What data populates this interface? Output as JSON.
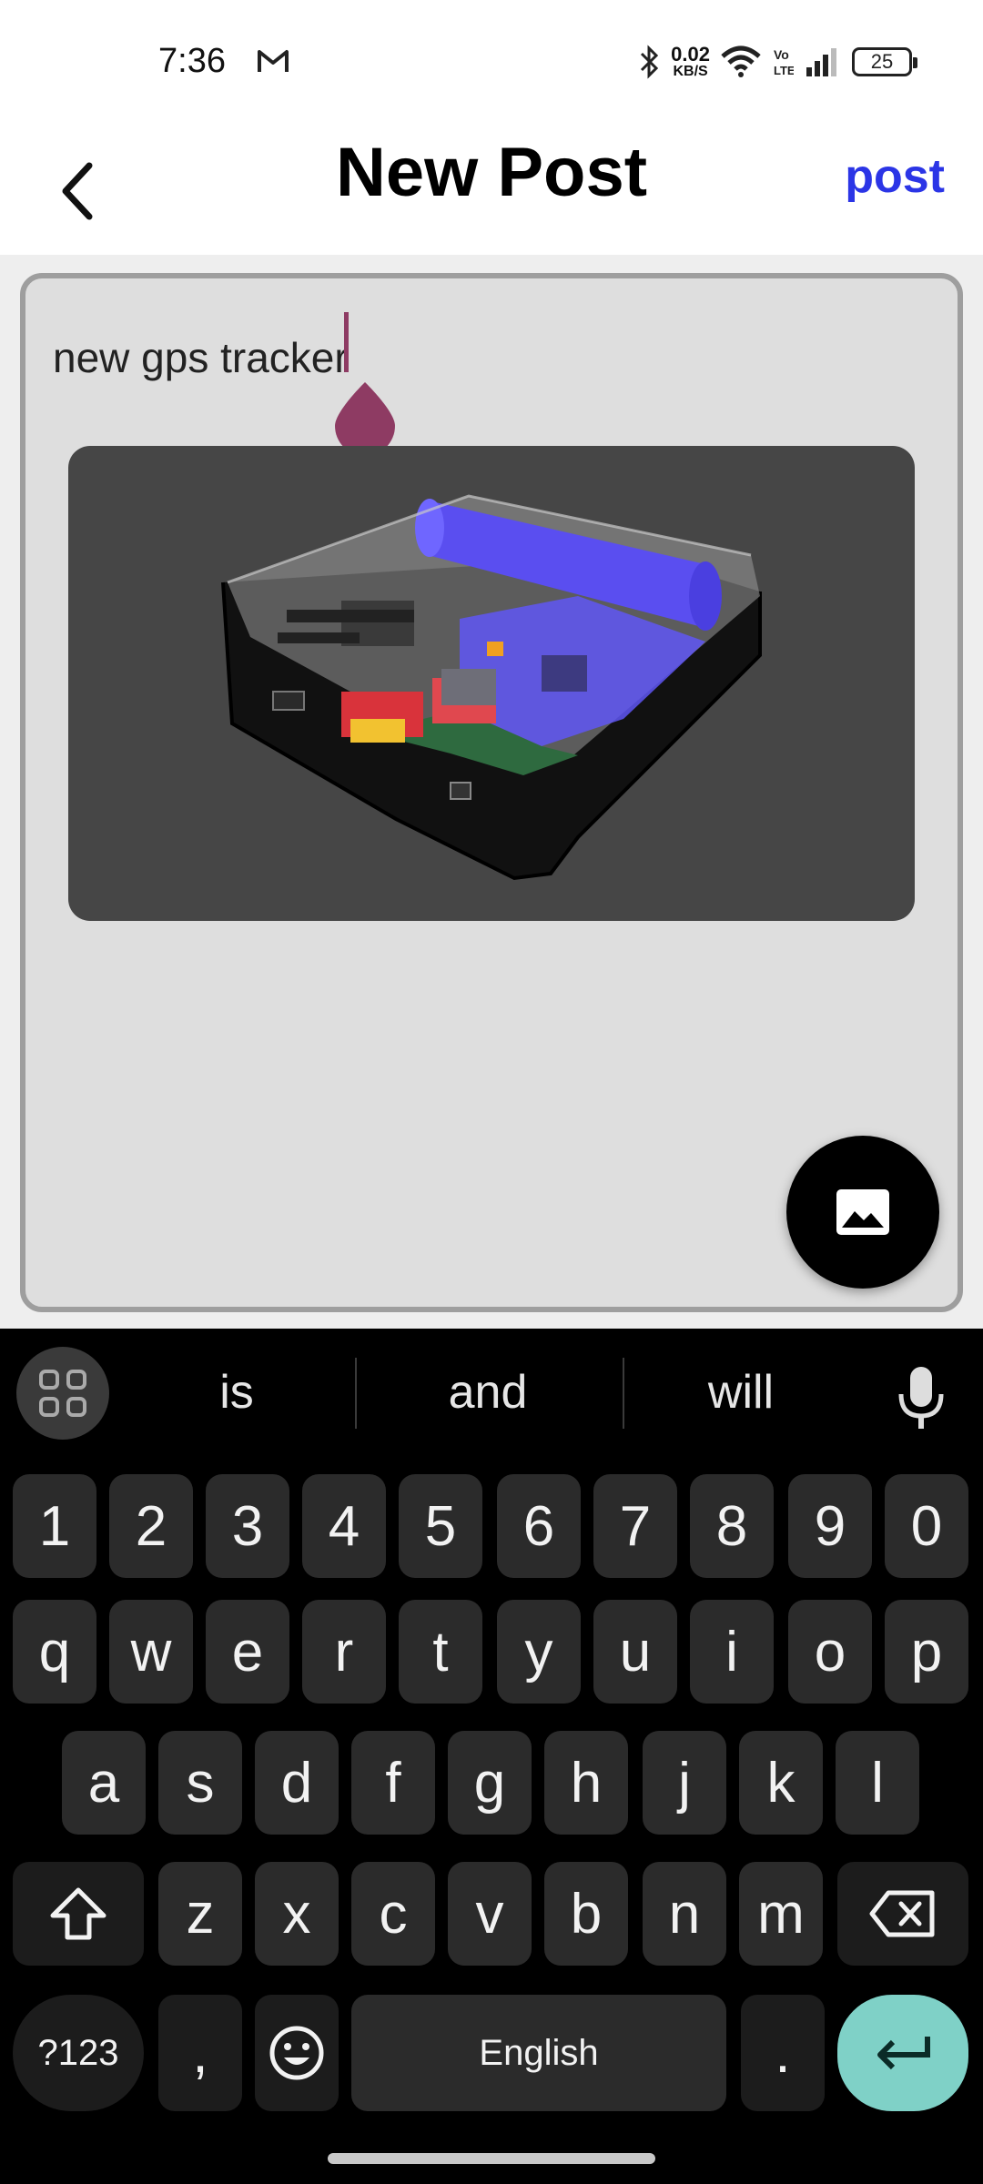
{
  "status_bar": {
    "time": "7:36",
    "net_speed_value": "0.02",
    "net_speed_unit": "KB/S",
    "battery_level": "25",
    "icons": [
      "gmail-icon",
      "bluetooth-icon",
      "wifi-icon",
      "volte-icon",
      "signal-icon",
      "battery-icon"
    ]
  },
  "app_bar": {
    "title": "New Post",
    "post_label": "post",
    "post_color": "#2b35e6"
  },
  "editor": {
    "text": "new gps tracker",
    "caret_color": "#8e3b63",
    "image_icon": "image-icon"
  },
  "keyboard": {
    "suggestions": [
      "is",
      "and",
      "will"
    ],
    "rows": {
      "numbers": [
        "1",
        "2",
        "3",
        "4",
        "5",
        "6",
        "7",
        "8",
        "9",
        "0"
      ],
      "row1": [
        "q",
        "w",
        "e",
        "r",
        "t",
        "y",
        "u",
        "i",
        "o",
        "p"
      ],
      "row2": [
        "a",
        "s",
        "d",
        "f",
        "g",
        "h",
        "j",
        "k",
        "l"
      ],
      "row3": [
        "z",
        "x",
        "c",
        "v",
        "b",
        "n",
        "m"
      ]
    },
    "symbols_label": "?123",
    "comma_label": ",",
    "space_label": "English",
    "period_label": ".",
    "enter_color": "#7fd1c7"
  }
}
